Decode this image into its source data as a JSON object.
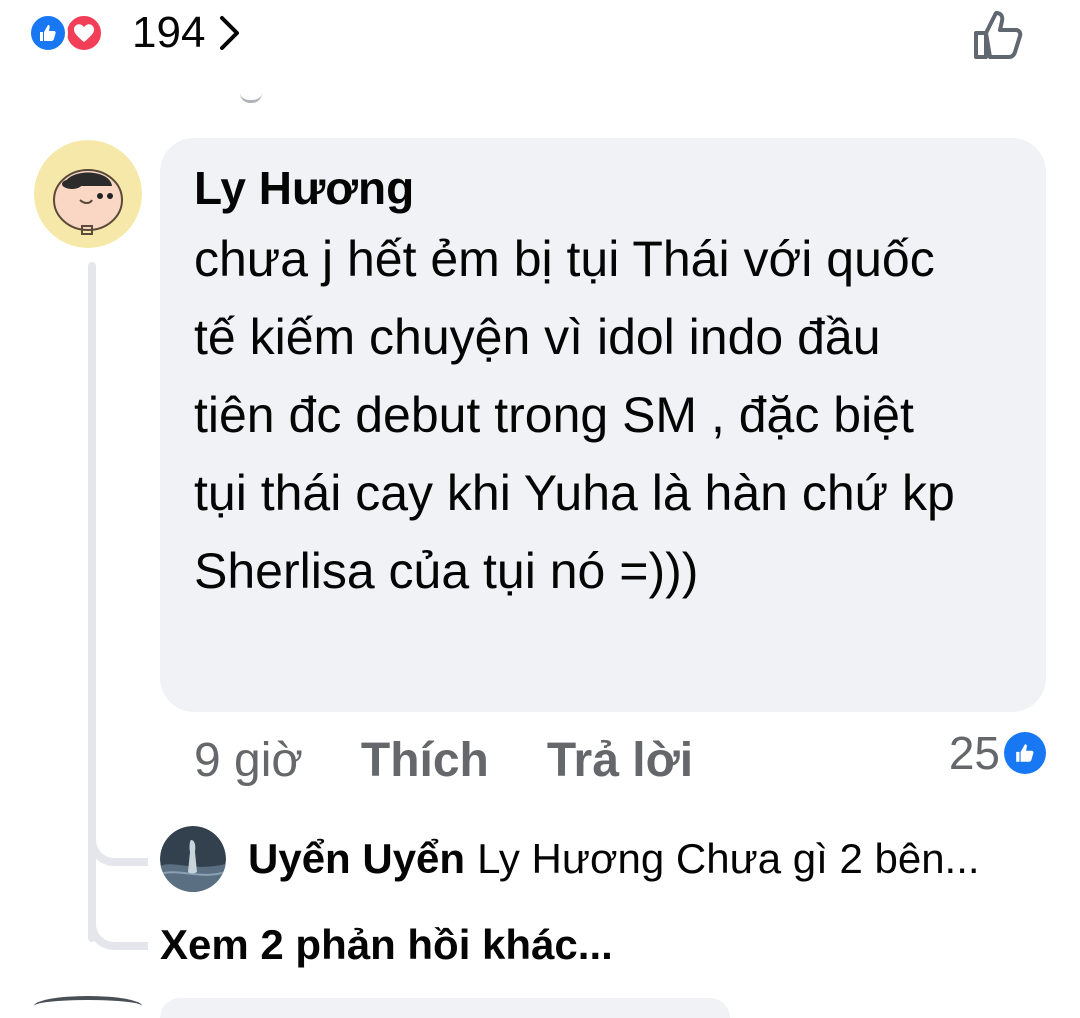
{
  "reactions": {
    "count": "194",
    "types": [
      "like-icon",
      "love-icon"
    ],
    "like_color": "#1877f2",
    "love_color": "#f33e58"
  },
  "comment": {
    "author": "Ly Hương",
    "text": "chưa j hết ẻm bị tụi Thái với quốc tế kiếm chuyện vì idol indo đầu tiên đc debut trong SM , đặc biệt tụi thái cay khi Yuha là hàn chứ kp Sherlisa của tụi nó =)))",
    "time": "9 giờ",
    "like_action": "Thích",
    "reply_action": "Trả lời",
    "like_count": "25"
  },
  "reply": {
    "author": "Uyển Uyển",
    "snippet": "Ly Hương Chưa gì 2 bên..."
  },
  "more_replies_label": "Xem 2 phản hồi khác...",
  "colors": {
    "bubble": "#f0f2f5",
    "secondary_text": "#65676b",
    "thread_line": "#e4e6eb",
    "accent": "#1877f2"
  }
}
